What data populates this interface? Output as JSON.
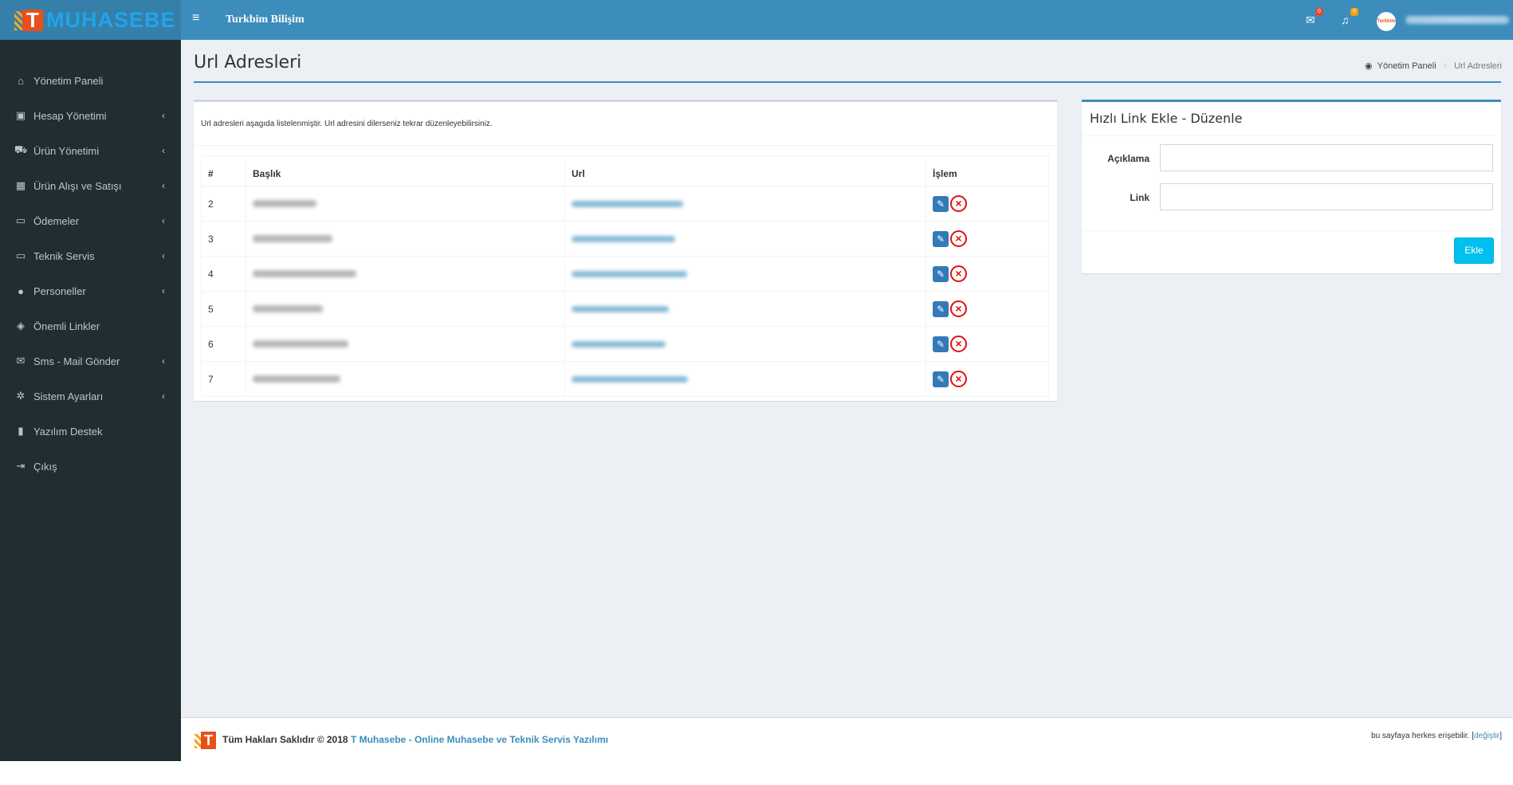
{
  "header": {
    "logo_letter": "T",
    "logo_text": "MUHASEBE",
    "company": "Turkbim Bilişim",
    "mail_count": "0",
    "notif_count": "0",
    "avatar_text": "Turkbim"
  },
  "sidebar": {
    "items": [
      {
        "label": "Yönetim Paneli",
        "icon": "home-icon",
        "glyph": "⌂",
        "has_children": false
      },
      {
        "label": "Hesap Yönetimi",
        "icon": "money-icon",
        "glyph": "▣",
        "has_children": true
      },
      {
        "label": "Ürün Yönetimi",
        "icon": "cart-icon",
        "glyph": "⛟",
        "has_children": true
      },
      {
        "label": "Ürün Alışı ve Satışı",
        "icon": "grid-icon",
        "glyph": "▦",
        "has_children": true
      },
      {
        "label": "Ödemeler",
        "icon": "credit-card-icon",
        "glyph": "▭",
        "has_children": true
      },
      {
        "label": "Teknik Servis",
        "icon": "laptop-icon",
        "glyph": "▭",
        "has_children": true
      },
      {
        "label": "Personeller",
        "icon": "user-icon",
        "glyph": "●",
        "has_children": true
      },
      {
        "label": "Önemli Linkler",
        "icon": "tags-icon",
        "glyph": "◈",
        "has_children": false
      },
      {
        "label": "Sms - Mail Gönder",
        "icon": "envelope-icon",
        "glyph": "✉",
        "has_children": true
      },
      {
        "label": "Sistem Ayarları",
        "icon": "gear-icon",
        "glyph": "✲",
        "has_children": true
      },
      {
        "label": "Yazılım Destek",
        "icon": "bookmark-icon",
        "glyph": "▮",
        "has_children": false
      },
      {
        "label": "Çıkış",
        "icon": "sign-out-icon",
        "glyph": "⇥",
        "has_children": false
      }
    ]
  },
  "page": {
    "title": "Url Adresleri",
    "breadcrumb_home": "Yönetim Paneli",
    "breadcrumb_current": "Url Adresleri"
  },
  "list_box": {
    "intro": "Url adresleri aşagıda listelenmiştir. Url adresini dilerseniz tekrar düzenleyebilirsiniz.",
    "columns": [
      "#",
      "Başlık",
      "Url",
      "İşlem"
    ],
    "rows": [
      {
        "id": "2"
      },
      {
        "id": "3"
      },
      {
        "id": "4"
      },
      {
        "id": "5"
      },
      {
        "id": "6"
      },
      {
        "id": "7"
      }
    ]
  },
  "form_box": {
    "title": "Hızlı Link Ekle - Düzenle",
    "label_desc": "Açıklama",
    "label_link": "Link",
    "value_desc": "",
    "value_link": "",
    "submit": "Ekle"
  },
  "footer": {
    "copyright": "Tüm Hakları Saklıdır © 2018",
    "product": "T Muhasebe - Online Muhasebe ve Teknik Servis Yazılımı",
    "access": "bu sayfaya herkes erişebilir. [",
    "change": "değiştir",
    "close": "]"
  },
  "colors": {
    "primary": "#3c8dbc",
    "sidebar": "#222d32",
    "accent": "#00c0ef",
    "danger": "#e01010"
  }
}
